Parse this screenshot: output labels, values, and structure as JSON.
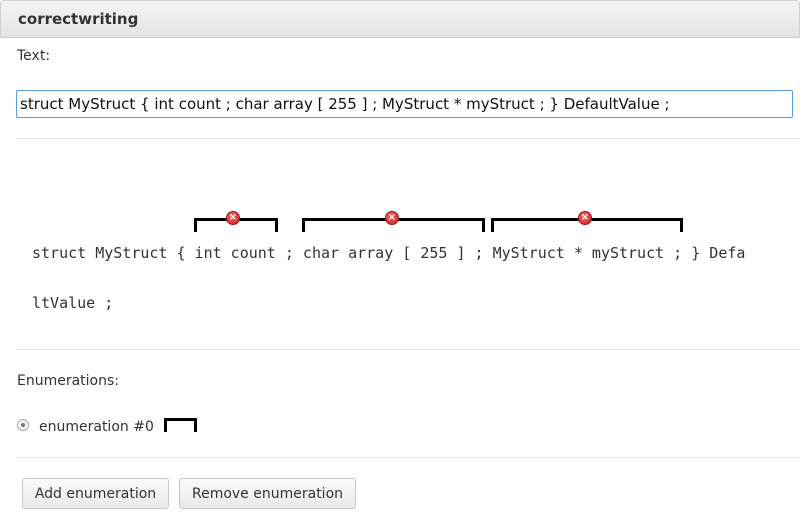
{
  "header": {
    "title": "correctwriting"
  },
  "text_label": "Text:",
  "text_value": "struct MyStruct { int count ; char array [ 255 ] ; MyStruct * myStruct ; } DefaultValue ;",
  "preview": {
    "line1": "struct MyStruct { int count ; char array [ 255 ] ; MyStruct * myStruct ; } Defa",
    "line2": "ltValue ;"
  },
  "error_icon_glyph": "×",
  "enumerations_label": "Enumerations:",
  "enumeration_item": "enumeration #0",
  "buttons": {
    "add": "Add enumeration",
    "remove": "Remove enumeration"
  }
}
